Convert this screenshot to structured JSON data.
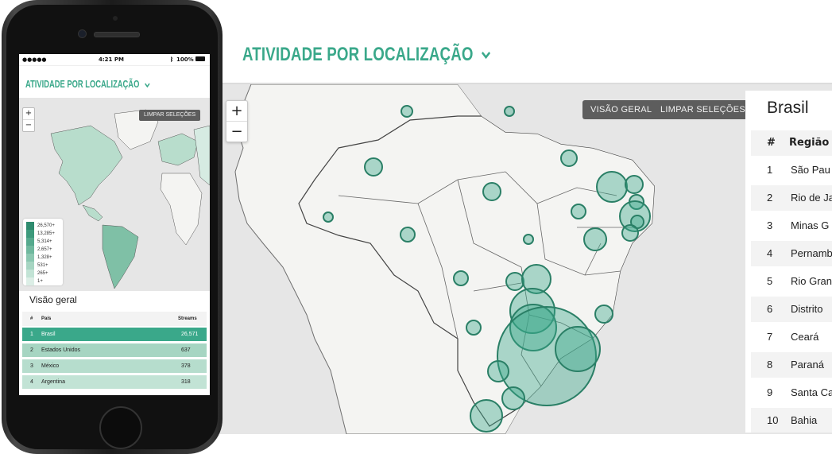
{
  "desktop": {
    "heading": "ATIVIDADE POR LOCALIZAÇÃO",
    "accent": "#3aa88a",
    "buttons": {
      "overview": "VISÃO GERAL",
      "clear": "LIMPAR SELEÇÕES"
    },
    "zoom": {
      "in": "+",
      "out": "−"
    },
    "table": {
      "title": "Brasil",
      "columns": [
        "#",
        "Região"
      ],
      "rows": [
        {
          "rank": "1",
          "region": "São Pau"
        },
        {
          "rank": "2",
          "region": "Rio de Ja"
        },
        {
          "rank": "3",
          "region": "Minas G"
        },
        {
          "rank": "4",
          "region": "Pernamb"
        },
        {
          "rank": "5",
          "region": "Rio Gran"
        },
        {
          "rank": "6",
          "region": "Distrito"
        },
        {
          "rank": "7",
          "region": "Ceará"
        },
        {
          "rank": "8",
          "region": "Paraná"
        },
        {
          "rank": "9",
          "region": "Santa Ca"
        },
        {
          "rank": "10",
          "region": "Bahia"
        }
      ]
    }
  },
  "phone": {
    "status": {
      "time": "4:21 PM",
      "battery": "100%"
    },
    "heading": "ATIVIDADE POR LOCALIZAÇÃO",
    "clear": "LIMPAR SELEÇÕES",
    "zoom": {
      "in": "+",
      "out": "−"
    },
    "legend": [
      "26,570+",
      "13,285+",
      "5,314+",
      "2,657+",
      "1,328+",
      "531+",
      "265+",
      "1+"
    ],
    "legend_colors": [
      "#2e8b6e",
      "#3d9a7c",
      "#55a98d",
      "#6fb89e",
      "#8ac7b0",
      "#a6d5c2",
      "#c2e3d5",
      "#dceee6"
    ],
    "overview_title": "Visão geral",
    "table_headers": {
      "rank": "#",
      "country": "País",
      "streams": "Streams"
    },
    "rows": [
      {
        "rank": "1",
        "country": "Brasil",
        "streams": "26,571"
      },
      {
        "rank": "2",
        "country": "Estados Unidos",
        "streams": "637"
      },
      {
        "rank": "3",
        "country": "México",
        "streams": "378"
      },
      {
        "rank": "4",
        "country": "Argentina",
        "streams": "318"
      }
    ]
  }
}
